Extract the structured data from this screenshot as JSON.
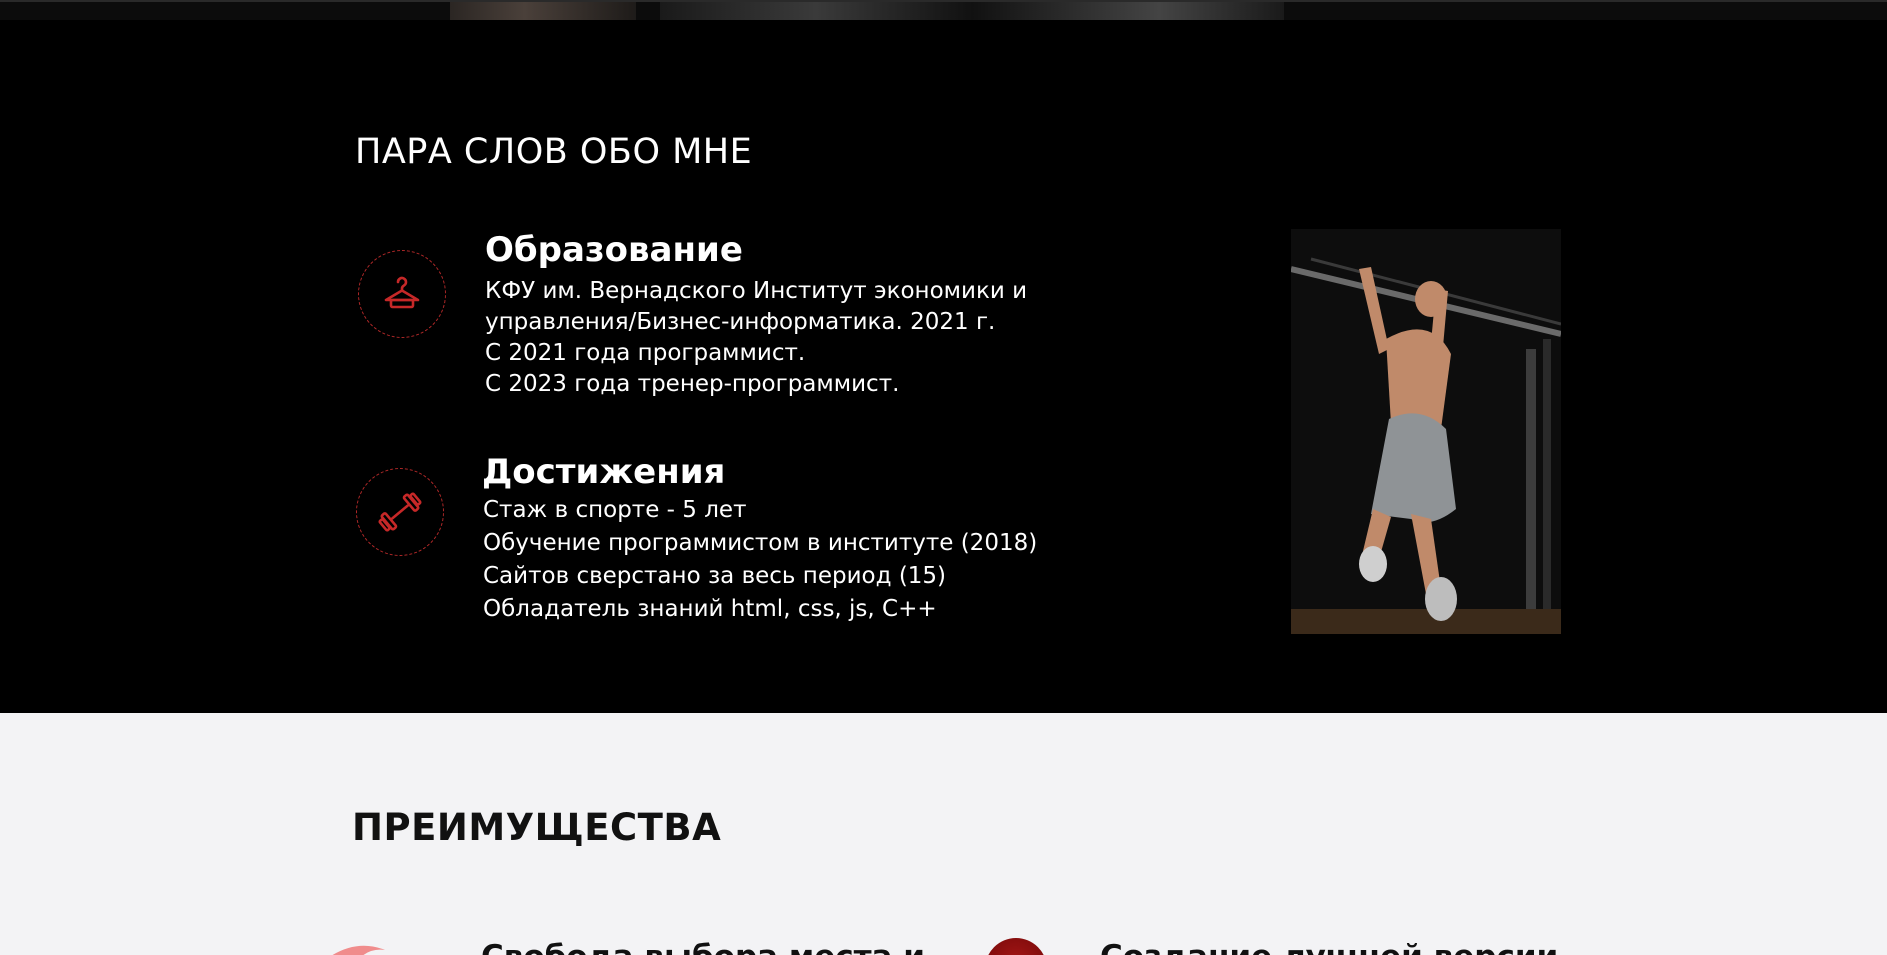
{
  "about": {
    "title": "ПАРА СЛОВ ОБО МНЕ",
    "education": {
      "title": "Образование",
      "icon": "hanger-icon",
      "lines": [
        "КФУ им. Вернадского Институт экономики и",
        "управления/Бизнес-информатика. 2021 г.",
        "С 2021 года программист.",
        "С 2023 года тренер-программист."
      ]
    },
    "achievements": {
      "title": "Достижения",
      "icon": "dumbbell-icon",
      "lines": [
        "Стаж в спорте - 5 лет",
        "Обучение программистом в институте (2018)",
        "Сайтов сверстано за весь период (15)",
        "Обладатель знаний html, css, js, C++"
      ]
    }
  },
  "advantages": {
    "title": "ПРЕИМУЩЕСТВА",
    "items": [
      {
        "title": "Свобода выбора места и"
      },
      {
        "title": "Создание лучшей версии"
      }
    ]
  },
  "colors": {
    "accent": "#c62828",
    "dark_bg": "#000000",
    "light_bg": "#f3f3f5"
  }
}
